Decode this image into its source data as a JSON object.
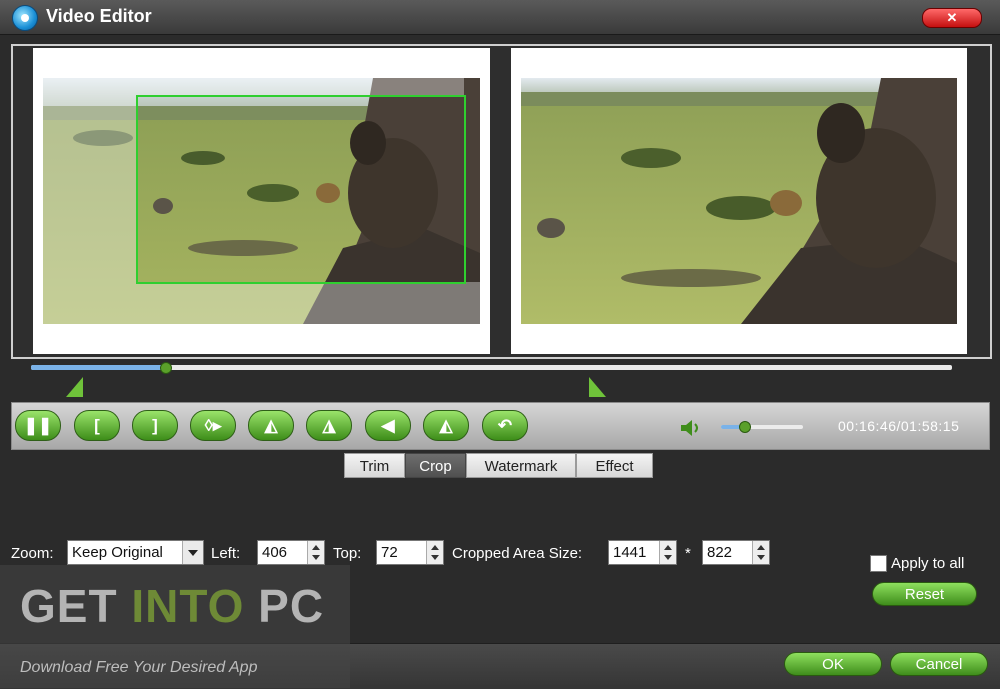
{
  "window": {
    "title": "Video Editor",
    "close_icon": "close-icon",
    "close_glyph": "✕"
  },
  "playback": {
    "timecode": "00:16:46/01:58:15",
    "progress": 0.145,
    "volume": 0.28
  },
  "toolbar": {
    "buttons": [
      {
        "name": "pause-button",
        "icon": "pause-icon",
        "glyph": "❚❚"
      },
      {
        "name": "mark-in-button",
        "icon": "bracket-left-icon",
        "glyph": "["
      },
      {
        "name": "mark-out-button",
        "icon": "bracket-right-icon",
        "glyph": "]"
      },
      {
        "name": "split-button",
        "icon": "split-icon",
        "glyph": "◊▸"
      },
      {
        "name": "flip-horizontal-button",
        "icon": "flip-horizontal-icon",
        "glyph": "◭"
      },
      {
        "name": "flip-vertical-button",
        "icon": "flip-vertical-icon",
        "glyph": "◮"
      },
      {
        "name": "rotate-left-button",
        "icon": "rotate-left-icon",
        "glyph": "◀"
      },
      {
        "name": "rotate-right-button",
        "icon": "rotate-right-icon",
        "glyph": "◭"
      },
      {
        "name": "undo-button",
        "icon": "undo-icon",
        "glyph": "↶"
      }
    ],
    "speaker_icon": "speaker-icon"
  },
  "tabs": [
    {
      "label": "Trim",
      "active": false
    },
    {
      "label": "Crop",
      "active": true
    },
    {
      "label": "Watermark",
      "active": false
    },
    {
      "label": "Effect",
      "active": false
    }
  ],
  "crop": {
    "zoom_label": "Zoom:",
    "zoom_value": "Keep Original",
    "left_label": "Left:",
    "left_value": "406",
    "top_label": "Top:",
    "top_value": "72",
    "size_label": "Cropped Area Size:",
    "width_value": "1441",
    "separator": "*",
    "height_value": "822"
  },
  "options": {
    "apply_to_all": "Apply to all",
    "apply_checked": false,
    "reset": "Reset"
  },
  "footer": {
    "ok": "OK",
    "cancel": "Cancel"
  },
  "watermark": {
    "part1": "GET ",
    "part2": "INTO",
    "part3": " PC",
    "tagline": "Download Free Your Desired App"
  },
  "colors": {
    "accent_green": "#5aa02a",
    "crop_frame": "#2fcf2f",
    "background": "#2b2b2b"
  }
}
